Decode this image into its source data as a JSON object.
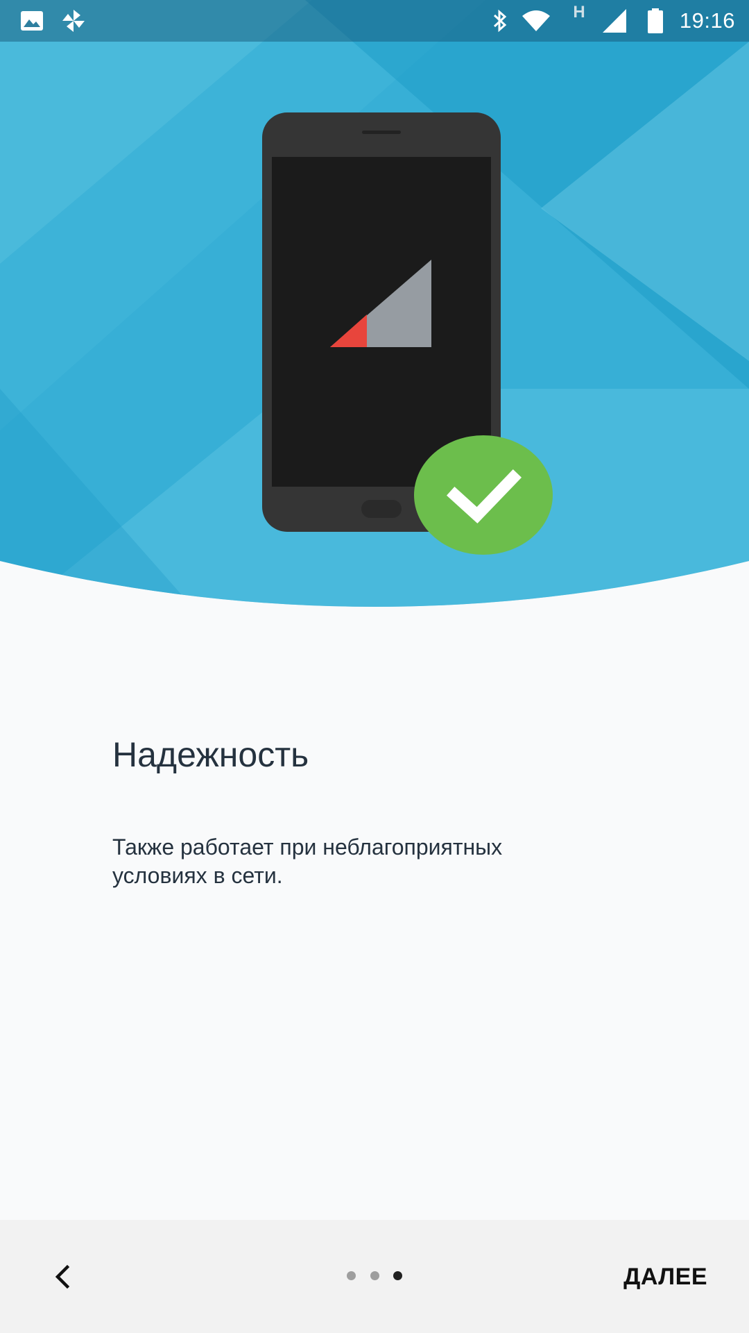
{
  "status_bar": {
    "time": "19:16",
    "left_icons": [
      "image-notification-icon",
      "pinwheel-notification-icon"
    ],
    "right_icons": [
      "bluetooth-icon",
      "wifi-icon",
      "hspa-icon",
      "cellular-signal-icon",
      "battery-icon"
    ],
    "network_type": "H"
  },
  "colors": {
    "hero_light": "#5bc2e0",
    "hero_mid": "#37afd6",
    "hero_dark": "#1f9cc8",
    "phone_body": "#353535",
    "phone_screen": "#1b1b1b",
    "signal_gray": "#969ca2",
    "signal_red": "#e8453c",
    "check_green": "#6cbe4c",
    "text": "#25323f"
  },
  "content": {
    "title": "Надежность",
    "description": "Также работает при неблагоприятных условиях в сети."
  },
  "navigation": {
    "next_label": "ДАЛЕЕ",
    "page_count": 3,
    "current_page": 3
  }
}
